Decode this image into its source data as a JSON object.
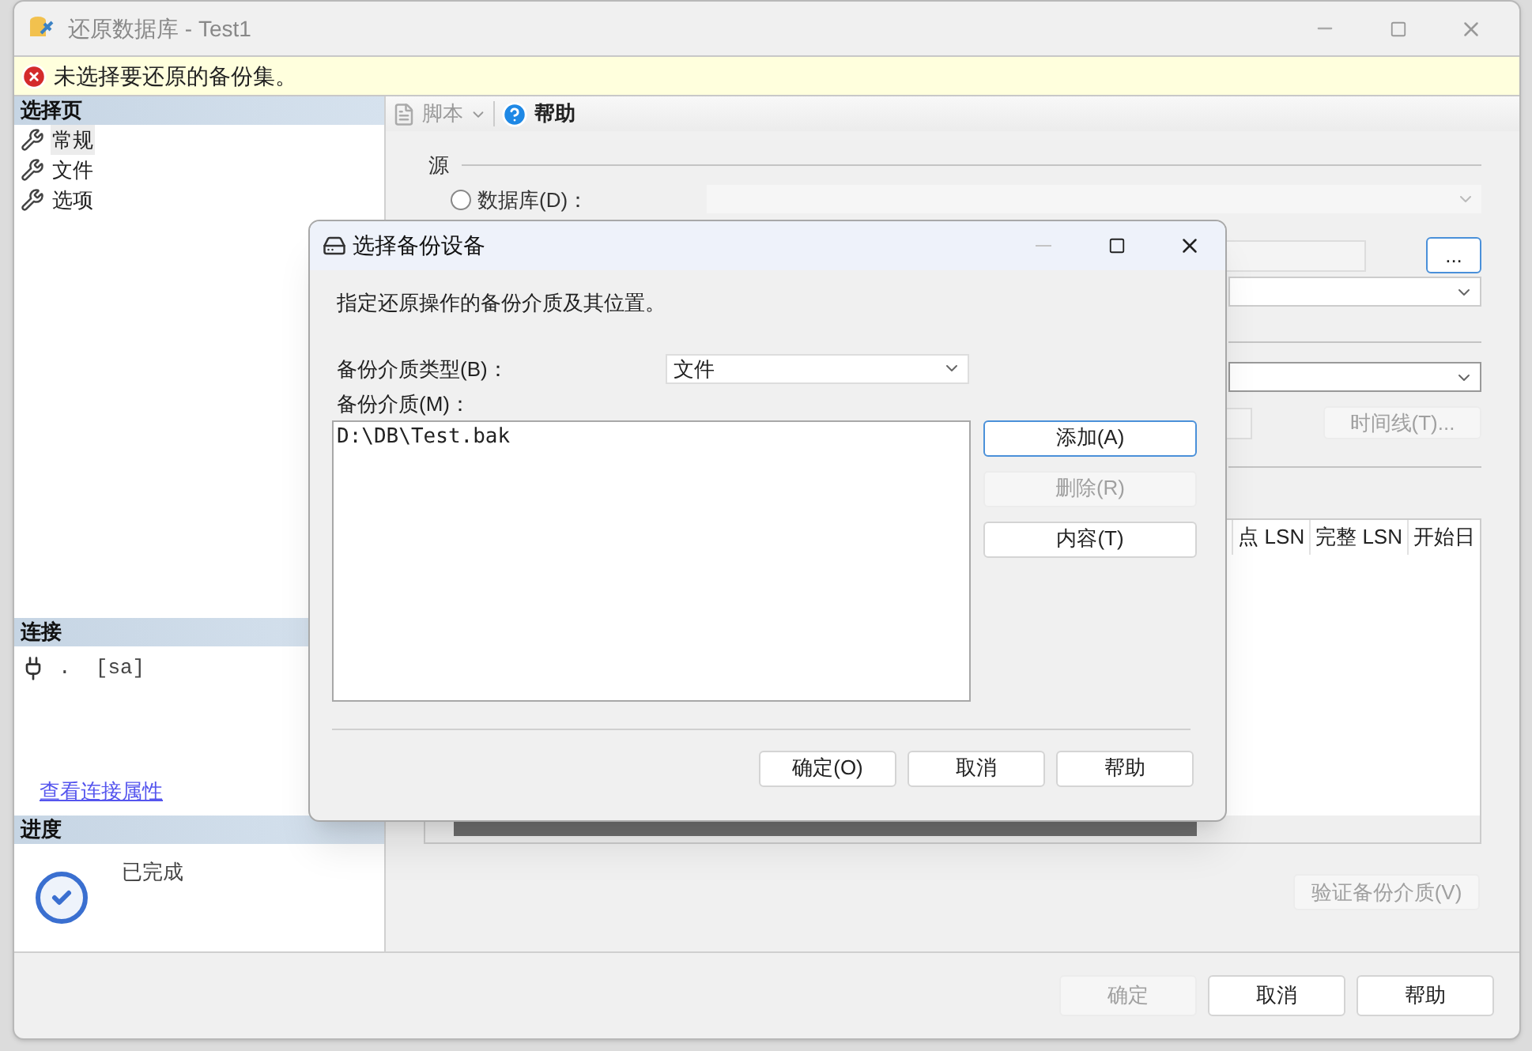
{
  "window": {
    "title": "还原数据库 - Test1"
  },
  "error_bar": {
    "message": "未选择要还原的备份集。"
  },
  "left_pane": {
    "select_page": {
      "header": "选择页",
      "items": [
        {
          "label": "常规",
          "selected": true
        },
        {
          "label": "文件",
          "selected": false
        },
        {
          "label": "选项",
          "selected": false
        }
      ]
    },
    "connection": {
      "header": "连接",
      "server": ".  [sa]",
      "link": "查看连接属性"
    },
    "progress": {
      "header": "进度",
      "status": "已完成"
    }
  },
  "toolbar": {
    "script": "脚本",
    "help": "帮助"
  },
  "source": {
    "heading": "源",
    "radio": {
      "label": "数据库(D)：",
      "selected": false
    }
  },
  "browse_button": {
    "label": "...",
    "disabled": false
  },
  "timeline_button": {
    "label": "时间线(T)...",
    "disabled": true
  },
  "table": {
    "columns": [
      "点 LSN",
      "完整 LSN",
      "开始日"
    ]
  },
  "verify_button": {
    "label": "验证备份介质(V)",
    "disabled": true
  },
  "buttons": [
    {
      "label": "确定",
      "disabled": true
    },
    {
      "label": "取消",
      "disabled": false
    },
    {
      "label": "帮助",
      "disabled": false
    }
  ],
  "dialog": {
    "title": "选择备份设备",
    "description": "指定还原操作的备份介质及其位置。",
    "media_type": {
      "label": "备份介质类型(B)：",
      "value": "文件"
    },
    "media": {
      "label": "备份介质(M)：",
      "items": [
        "D:\\DB\\Test.bak"
      ]
    },
    "side_buttons": [
      {
        "label": "添加(A)",
        "disabled": false,
        "focused": true
      },
      {
        "label": "删除(R)",
        "disabled": true,
        "focused": false
      },
      {
        "label": "内容(T)",
        "disabled": false,
        "focused": false
      }
    ],
    "buttons": [
      {
        "label": "确定(O)",
        "disabled": false
      },
      {
        "label": "取消",
        "disabled": false
      },
      {
        "label": "帮助",
        "disabled": false
      }
    ]
  }
}
